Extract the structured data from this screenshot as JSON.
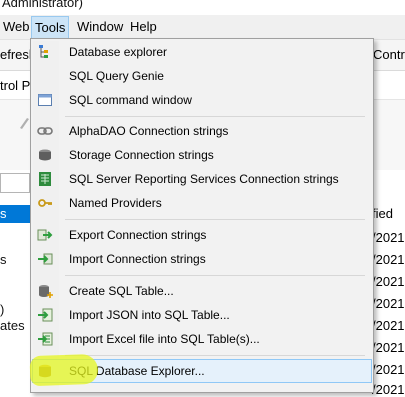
{
  "title_bar": {
    "text": "Administrator)"
  },
  "menubar": {
    "items": [
      {
        "label": "Web"
      },
      {
        "label": "Tools"
      },
      {
        "label": "Window"
      },
      {
        "label": "Help"
      }
    ]
  },
  "toolbar": {
    "left_text": "efresh",
    "right_text": "Contro"
  },
  "subbar": {
    "text": "trol Pa"
  },
  "left_panel": {
    "selected": "s",
    "items": [
      "s",
      ")",
      "ates"
    ]
  },
  "right_column": {
    "header": "fied",
    "cells": [
      "/2021",
      "/2021",
      "/2021",
      "/2021",
      "/2021",
      "/2021",
      "/2021",
      "/2021"
    ]
  },
  "tools_menu": {
    "items": [
      {
        "label": "Database explorer",
        "icon": "database-tree-icon"
      },
      {
        "label": "SQL Query Genie",
        "icon": "blank-icon"
      },
      {
        "label": "SQL command window",
        "icon": "window-icon"
      },
      {
        "label": "AlphaDAO Connection strings",
        "icon": "chain-link-icon"
      },
      {
        "label": "Storage Connection strings",
        "icon": "storage-drum-icon"
      },
      {
        "label": "SQL Server Reporting Services Connection strings",
        "icon": "report-grid-icon"
      },
      {
        "label": "Named Providers",
        "icon": "key-icon"
      },
      {
        "label": "Export Connection strings",
        "icon": "export-arrow-icon"
      },
      {
        "label": "Import Connection strings",
        "icon": "import-arrow-icon"
      },
      {
        "label": "Create SQL Table...",
        "icon": "create-table-icon"
      },
      {
        "label": "Import JSON into SQL Table...",
        "icon": "import-json-icon"
      },
      {
        "label": "Import Excel file into SQL Table(s)...",
        "icon": "import-excel-icon"
      },
      {
        "label": "SQL Database Explorer...",
        "icon": "database-cylinder-icon"
      }
    ]
  },
  "colors": {
    "menu_bg": "#f2f2f2",
    "hover_bg": "#e5f1fb",
    "hover_border": "#90c8f6",
    "selection": "#0078d7",
    "highlight": "#e6f51e"
  }
}
